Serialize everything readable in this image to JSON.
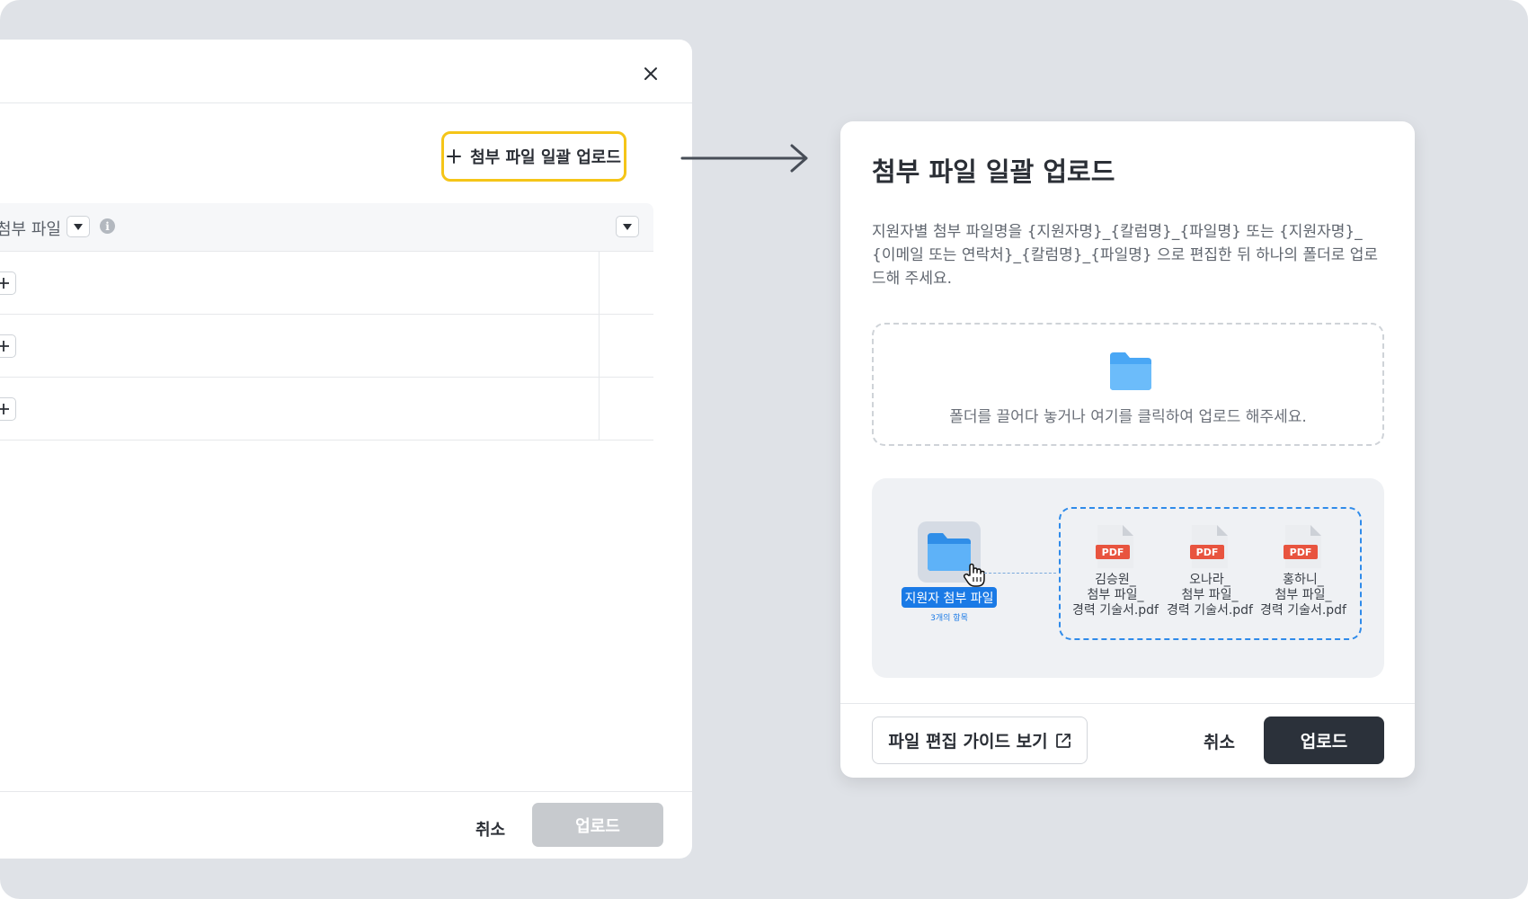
{
  "left_modal": {
    "bulk_upload_label": "첨부 파일 일괄 업로드",
    "table": {
      "column_label": "첨부 파일",
      "rows": 3
    },
    "footer": {
      "cancel_label": "취소",
      "upload_label": "업로드"
    }
  },
  "right_modal": {
    "title": "첨부 파일 일괄 업로드",
    "description": "지원자별 첨부 파일명을 {지원자명}_{칼럼명}_{파일명} 또는 {지원자명}_{이메일 또는 연락처}_{칼럼명}_{파일명} 으로 편집한 뒤 하나의 폴더로 업로드해 주세요.",
    "dropzone_text": "폴더를 끌어다 놓거나 여기를 클릭하여 업로드 해주세요.",
    "example": {
      "folder_name": "지원자 첨부 파일",
      "folder_count": "3개의 항목",
      "files": [
        {
          "badge": "PDF",
          "name": "김승원_\n첨부 파일_\n경력 기술서.pdf"
        },
        {
          "badge": "PDF",
          "name": "오나라_\n첨부 파일_\n경력 기술서.pdf"
        },
        {
          "badge": "PDF",
          "name": "홍하니_\n첨부 파일_\n경력 기술서.pdf"
        }
      ]
    },
    "footer": {
      "guide_label": "파일 편집 가이드 보기",
      "cancel_label": "취소",
      "upload_label": "업로드"
    }
  },
  "colors": {
    "background": "#dfe2e7",
    "highlight": "#f5c518",
    "accent_blue": "#1a7ae6",
    "primary_button": "#2b313a",
    "disabled_button": "#c7cace",
    "pdf_badge": "#e8543f"
  }
}
